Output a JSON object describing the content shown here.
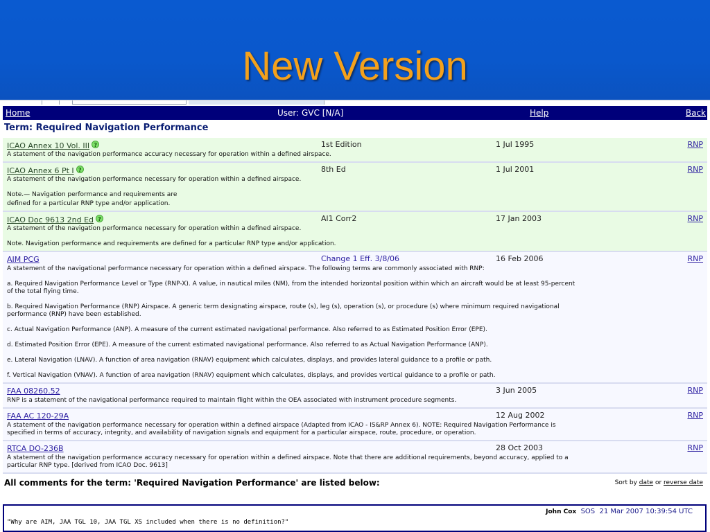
{
  "slide": {
    "title": "New Version"
  },
  "nav": {
    "home": "Home",
    "user": "User: GVC [N/A]",
    "help": "Help",
    "back": "Back"
  },
  "term": {
    "prefix": "Term: ",
    "name": "Required Navigation Performance"
  },
  "entries": [
    {
      "source": "ICAO Annex 10 Vol. III",
      "has_help": true,
      "edition": "1st Edition",
      "date": "1 Jul 1995",
      "tag": "RNP",
      "lines": [
        "A statement of the navigation performance accuracy necessary for operation within a defined airspace."
      ]
    },
    {
      "source": "ICAO Annex 6 Pt I",
      "has_help": true,
      "edition": "8th Ed",
      "date": "1 Jul 2001",
      "tag": "RNP",
      "lines": [
        "A statement of the navigation performance necessary for operation within a defined airspace.",
        "Note.— Navigation performance and requirements are",
        "defined for a particular RNP type and/or application."
      ]
    },
    {
      "source": "ICAO Doc 9613 2nd Ed",
      "has_help": true,
      "edition": "Al1 Corr2",
      "date": "17 Jan 2003",
      "tag": "RNP",
      "lines": [
        "A statement of the navigation performance necessary for operation within a defined airspace.",
        "Note. Navigation performance and requirements are defined for a particular RNP type and/or application."
      ]
    },
    {
      "source": "AIM PCG",
      "edition": "Change 1 Eff. 3/8/06",
      "date": "16 Feb 2006",
      "tag": "RNP",
      "lines": [
        "A statement of the navigational performance necessary for operation within a defined airspace. The following terms are commonly associated with RNP:",
        "a. Required Navigation Performance Level or Type (RNP-X). A value, in nautical miles (NM), from the intended horizontal position within which an aircraft would be at least 95-percent of the total flying time.",
        "b. Required Navigation Performance (RNP) Airspace. A generic term designating airspace, route (s), leg (s), operation (s), or procedure (s) where minimum required navigational performance (RNP) have been established.",
        "c. Actual Navigation Performance (ANP). A measure of the current estimated navigational performance. Also referred to as Estimated Position Error (EPE).",
        "d. Estimated Position Error (EPE). A measure of the current estimated navigational performance. Also referred to as Actual Navigation Performance (ANP).",
        "e. Lateral Navigation (LNAV). A function of area navigation (RNAV) equipment which calculates, displays, and provides lateral guidance to a profile or path.",
        "f. Vertical Navigation (VNAV). A function of area navigation (RNAV) equipment which calculates, displays, and provides vertical guidance to a profile or path."
      ]
    },
    {
      "source": "FAA 08260.52",
      "edition": "",
      "date": "3 Jun 2005",
      "tag": "RNP",
      "lines": [
        "RNP is a statement of the navigational performance required to maintain flight within the OEA associated with instrument procedure segments."
      ]
    },
    {
      "source": "FAA AC 120-29A",
      "edition": "",
      "date": "12 Aug 2002",
      "tag": "RNP",
      "lines": [
        "A statement of the navigation performance necessary for operation within a defined airspace (Adapted from ICAO - IS&RP Annex 6). NOTE: Required Navigation Performance is specified in terms of accuracy, integrity, and availability of navigation signals and equipment for a particular airspace, route, procedure, or operation."
      ]
    },
    {
      "source": "RTCA DO-236B",
      "edition": "",
      "date": "28 Oct 2003",
      "tag": "RNP",
      "lines": [
        "A statement of the navigation performance accuracy necessary for operation within a defined airspace. Note that there are additional requirements, beyond accuracy, applied to a particular RNP type. [derived from ICAO Doc. 9613]"
      ]
    }
  ],
  "comments": {
    "title": "All comments for the term: 'Required Navigation Performance' are listed below:",
    "sort_prefix": "Sort by ",
    "sort_date": "date",
    "sort_or": " or ",
    "sort_reverse": "reverse date",
    "items": [
      {
        "author": "John Cox",
        "org": "SOS",
        "timestamp": "21 Mar 2007  10:39:54 UTC",
        "text": "\"Why are AIM, JAA TGL 10, JAA TGL XS included when there is no definition?\""
      }
    ]
  }
}
